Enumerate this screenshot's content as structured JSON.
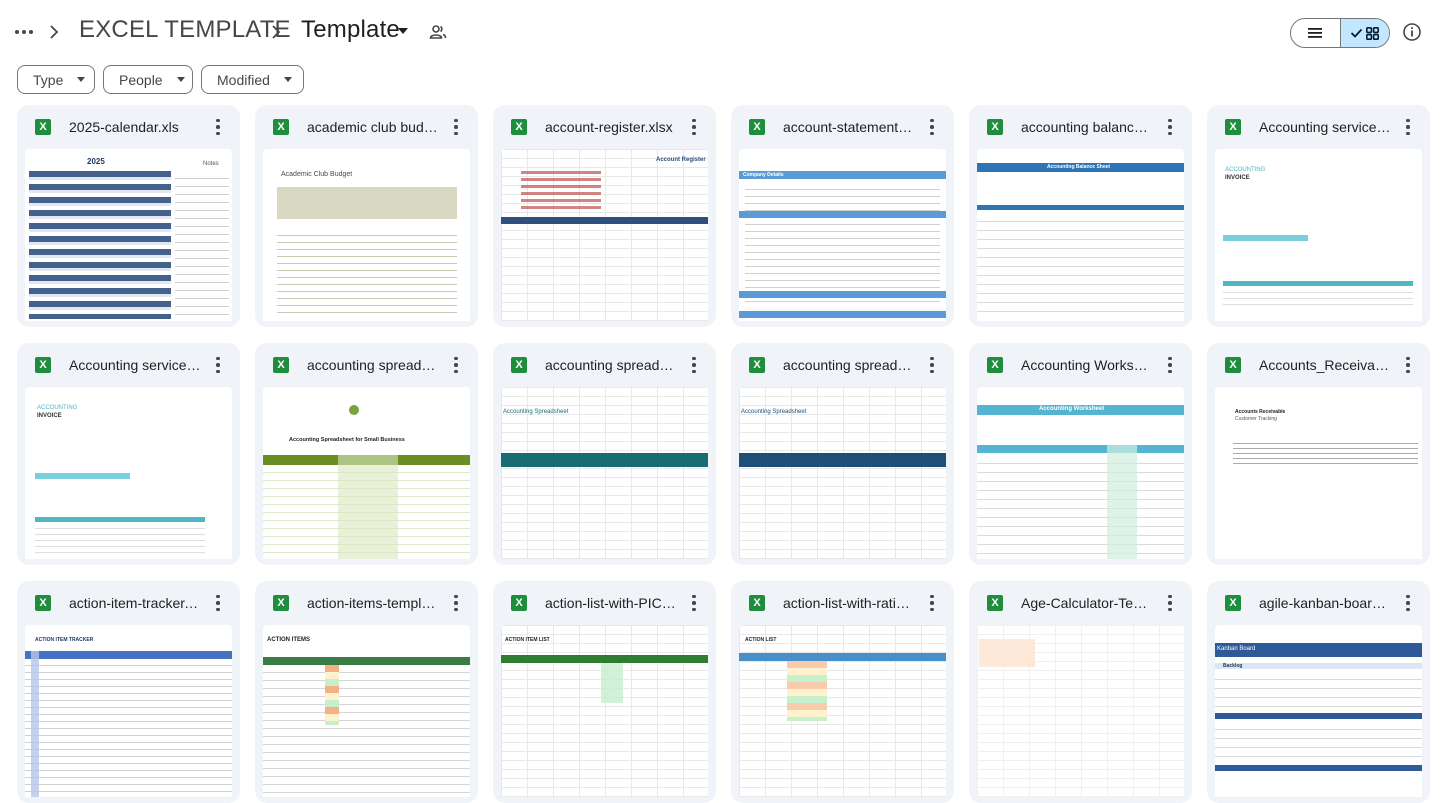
{
  "breadcrumb": {
    "root": "EXCEL TEMPLATE",
    "current": "Template"
  },
  "filters": [
    {
      "label": "Type"
    },
    {
      "label": "People"
    },
    {
      "label": "Modified"
    }
  ],
  "files": [
    {
      "name": "2025-calendar.xls",
      "thumb_title": "2025",
      "thumb_subtitle": "Notes"
    },
    {
      "name": "academic club budget.xlsx",
      "thumb_title": "Academic Club Budget"
    },
    {
      "name": "account-register.xlsx",
      "thumb_title": "Account Register"
    },
    {
      "name": "account-statement.xlsx",
      "thumb_title": "Company Details"
    },
    {
      "name": "accounting balance sheet.xlsx",
      "thumb_title": "Accounting Balance Sheet"
    },
    {
      "name": "Accounting service invoice.xlsx",
      "thumb_title": "ACCOUNTING",
      "thumb_subtitle": "INVOICE"
    },
    {
      "name": "Accounting service invoice.xlsx",
      "thumb_title": "ACCOUNTING",
      "thumb_subtitle": "INVOICE"
    },
    {
      "name": "accounting spreadsheet.xlsx",
      "thumb_title": "Accounting Spreadsheet for Small Business"
    },
    {
      "name": "accounting spreadsheet.xlsx",
      "thumb_title": "Accounting Spreadsheet"
    },
    {
      "name": "accounting spreadsheet.xlsx",
      "thumb_title": "Accounting Spreadsheet"
    },
    {
      "name": "Accounting Worksheet.xlsx",
      "thumb_title": "Accounting Worksheet"
    },
    {
      "name": "Accounts_Receivable.xlsx",
      "thumb_title": "Accounts Receivable",
      "thumb_subtitle": "Customer Tracking"
    },
    {
      "name": "action-item-tracker.xlsx",
      "thumb_title": "ACTION ITEM TRACKER"
    },
    {
      "name": "action-items-template.xlsx",
      "thumb_title": "ACTION ITEMS"
    },
    {
      "name": "action-list-with-PIC.xlsx",
      "thumb_title": "ACTION ITEM LIST"
    },
    {
      "name": "action-list-with-rating.xlsx",
      "thumb_title": "ACTION LIST"
    },
    {
      "name": "Age-Calculator-Template.xlsx",
      "thumb_title": ""
    },
    {
      "name": "agile-kanban-board.xlsx",
      "thumb_title": "Kanban Board",
      "thumb_subtitle": "Backlog"
    }
  ],
  "colors": {
    "excel_green": "#1e8e3e",
    "card_bg": "#f0f4f9",
    "toggle_active": "#c2e7ff"
  }
}
